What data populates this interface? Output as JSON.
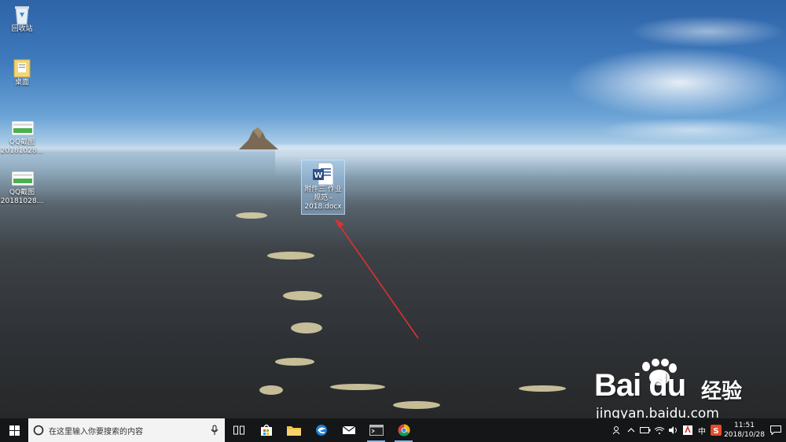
{
  "desktop": {
    "icons": [
      {
        "name": "recycle-bin",
        "label": "回收站"
      },
      {
        "name": "folder",
        "label": "桌面"
      },
      {
        "name": "qq-screenshot-1",
        "label_lines": [
          "QQ截图",
          "20181028..."
        ]
      },
      {
        "name": "qq-screenshot-2",
        "label_lines": [
          "QQ截图",
          "20181028..."
        ]
      },
      {
        "name": "word-doc",
        "label_lines": [
          "附件三 作业",
          "规范 -",
          "2018.docx"
        ],
        "selected": true
      }
    ]
  },
  "watermark": {
    "brand": "Bai du",
    "brand_cn": "经验",
    "url": "jingyan.baidu.com"
  },
  "taskbar": {
    "search_placeholder": "在这里输入你要搜索的内容",
    "apps": [
      "task-view-icon",
      "store-icon",
      "file-explorer-icon",
      "edge-icon",
      "mail-icon",
      "terminal-icon",
      "chrome-icon"
    ],
    "tray": {
      "ime": "中",
      "time": "11:51",
      "date": "2018/10/28"
    }
  },
  "colors": {
    "taskbar_bg": "#141618",
    "selection": "#a0c8f0",
    "arrow": "#e03030",
    "word_blue": "#2b579a"
  }
}
